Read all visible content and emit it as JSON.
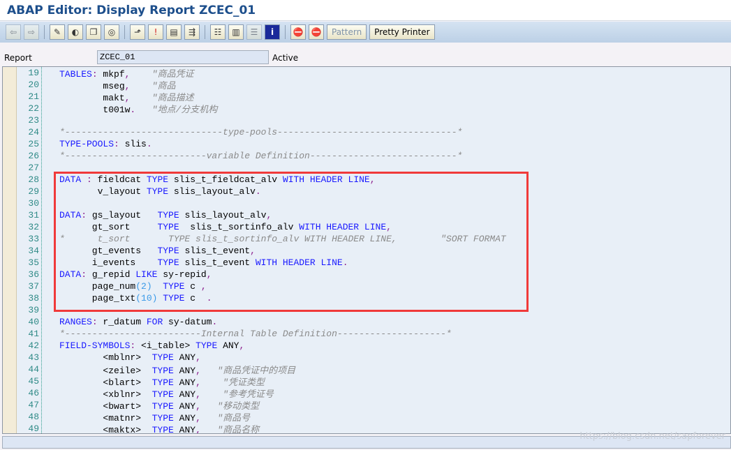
{
  "window_title": "ABAP Editor: Display Report ZCEC_01",
  "toolbar": {
    "icons": [
      "arrow-left-icon",
      "arrow-right-icon",
      "edit-pencil-icon",
      "toggle-active-icon",
      "object-copy-icon",
      "where-used-icon",
      "hierarchy-up-icon",
      "breakpoint-icon",
      "display-screen-icon",
      "navigate-icon",
      "object-tree-icon",
      "printer-icon",
      "list-icon",
      "info-icon",
      "stop-breakpoint-icon",
      "session-breakpoint-icon"
    ],
    "pattern_label": "Pattern",
    "pretty_printer_label": "Pretty Printer"
  },
  "report": {
    "label": "Report",
    "value": "ZCEC_01",
    "status": "Active"
  },
  "code_lines": [
    {
      "n": "19",
      "s": [
        [
          "k",
          "TABLES"
        ],
        [
          "p",
          ":"
        ],
        [
          "t",
          " mkpf"
        ],
        [
          "p",
          ","
        ],
        [
          "t",
          "    "
        ],
        [
          "c",
          "\"商品凭证"
        ]
      ]
    },
    {
      "n": "20",
      "s": [
        [
          "t",
          "        mseg"
        ],
        [
          "p",
          ","
        ],
        [
          "t",
          "    "
        ],
        [
          "c",
          "\"商品"
        ]
      ]
    },
    {
      "n": "21",
      "s": [
        [
          "t",
          "        makt"
        ],
        [
          "p",
          ","
        ],
        [
          "t",
          "    "
        ],
        [
          "c",
          "\"商品描述"
        ]
      ]
    },
    {
      "n": "22",
      "s": [
        [
          "t",
          "        t001w"
        ],
        [
          "p",
          "."
        ],
        [
          "t",
          "   "
        ],
        [
          "c",
          "\"地点/分支机构"
        ]
      ]
    },
    {
      "n": "23",
      "s": []
    },
    {
      "n": "24",
      "s": [
        [
          "c",
          "*-----------------------------type-pools---------------------------------*"
        ]
      ]
    },
    {
      "n": "25",
      "s": [
        [
          "k",
          "TYPE-POOLS"
        ],
        [
          "p",
          ":"
        ],
        [
          "t",
          " slis"
        ],
        [
          "p",
          "."
        ]
      ]
    },
    {
      "n": "26",
      "s": [
        [
          "c",
          "*--------------------------variable Definition---------------------------*"
        ]
      ]
    },
    {
      "n": "27",
      "s": []
    },
    {
      "n": "28",
      "s": [
        [
          "k",
          "DATA"
        ],
        [
          "t",
          " "
        ],
        [
          "p",
          ":"
        ],
        [
          "t",
          " fieldcat "
        ],
        [
          "k",
          "TYPE"
        ],
        [
          "t",
          " slis_t_fieldcat_alv "
        ],
        [
          "k",
          "WITH HEADER LINE"
        ],
        [
          "p",
          ","
        ]
      ]
    },
    {
      "n": "29",
      "s": [
        [
          "t",
          "       v_layout "
        ],
        [
          "k",
          "TYPE"
        ],
        [
          "t",
          " slis_layout_alv"
        ],
        [
          "p",
          "."
        ]
      ]
    },
    {
      "n": "30",
      "s": []
    },
    {
      "n": "31",
      "s": [
        [
          "k",
          "DATA"
        ],
        [
          "p",
          ":"
        ],
        [
          "t",
          " gs_layout   "
        ],
        [
          "k",
          "TYPE"
        ],
        [
          "t",
          " slis_layout_alv"
        ],
        [
          "p",
          ","
        ]
      ]
    },
    {
      "n": "32",
      "s": [
        [
          "t",
          "      gt_sort     "
        ],
        [
          "k",
          "TYPE"
        ],
        [
          "t",
          "  slis_t_sortinfo_alv "
        ],
        [
          "k",
          "WITH HEADER LINE"
        ],
        [
          "p",
          ","
        ]
      ]
    },
    {
      "n": "33",
      "s": [
        [
          "c",
          "*      t_sort       TYPE slis_t_sortinfo_alv WITH HEADER LINE,        \"SORT FORMAT"
        ]
      ]
    },
    {
      "n": "34",
      "s": [
        [
          "t",
          "      gt_events   "
        ],
        [
          "k",
          "TYPE"
        ],
        [
          "t",
          " slis_t_event"
        ],
        [
          "p",
          ","
        ]
      ]
    },
    {
      "n": "35",
      "s": [
        [
          "t",
          "      i_events    "
        ],
        [
          "k",
          "TYPE"
        ],
        [
          "t",
          " slis_t_event "
        ],
        [
          "k",
          "WITH HEADER LINE"
        ],
        [
          "p",
          "."
        ]
      ]
    },
    {
      "n": "36",
      "s": [
        [
          "k",
          "DATA"
        ],
        [
          "p",
          ":"
        ],
        [
          "t",
          " g_repid "
        ],
        [
          "k",
          "LIKE"
        ],
        [
          "t",
          " sy-repid"
        ],
        [
          "p",
          ","
        ]
      ]
    },
    {
      "n": "37",
      "s": [
        [
          "t",
          "      page_num"
        ],
        [
          "n",
          "(2)"
        ],
        [
          "t",
          "  "
        ],
        [
          "k",
          "TYPE"
        ],
        [
          "t",
          " c "
        ],
        [
          "p",
          ","
        ]
      ]
    },
    {
      "n": "38",
      "s": [
        [
          "t",
          "      page_txt"
        ],
        [
          "n",
          "(10)"
        ],
        [
          "t",
          " "
        ],
        [
          "k",
          "TYPE"
        ],
        [
          "t",
          " c  "
        ],
        [
          "p",
          "."
        ]
      ]
    },
    {
      "n": "39",
      "s": []
    },
    {
      "n": "40",
      "s": [
        [
          "k",
          "RANGES"
        ],
        [
          "p",
          ":"
        ],
        [
          "t",
          " r_datum "
        ],
        [
          "k",
          "FOR"
        ],
        [
          "t",
          " sy-datum"
        ],
        [
          "p",
          "."
        ]
      ]
    },
    {
      "n": "41",
      "s": [
        [
          "c",
          "*-------------------------Internal Table Definition--------------------*"
        ]
      ]
    },
    {
      "n": "42",
      "s": [
        [
          "k",
          "FIELD-SYMBOLS"
        ],
        [
          "p",
          ":"
        ],
        [
          "t",
          " <i_table> "
        ],
        [
          "k",
          "TYPE"
        ],
        [
          "t",
          " ANY"
        ],
        [
          "p",
          ","
        ]
      ]
    },
    {
      "n": "43",
      "s": [
        [
          "t",
          "        <mblnr>  "
        ],
        [
          "k",
          "TYPE"
        ],
        [
          "t",
          " ANY"
        ],
        [
          "p",
          ","
        ]
      ]
    },
    {
      "n": "44",
      "s": [
        [
          "t",
          "        <zeile>  "
        ],
        [
          "k",
          "TYPE"
        ],
        [
          "t",
          " ANY"
        ],
        [
          "p",
          ","
        ],
        [
          "t",
          "   "
        ],
        [
          "c",
          "\"商品凭证中的项目"
        ]
      ]
    },
    {
      "n": "45",
      "s": [
        [
          "t",
          "        <blart>  "
        ],
        [
          "k",
          "TYPE"
        ],
        [
          "t",
          " ANY"
        ],
        [
          "p",
          ","
        ],
        [
          "t",
          "    "
        ],
        [
          "c",
          "\"凭证类型"
        ]
      ]
    },
    {
      "n": "46",
      "s": [
        [
          "t",
          "        <xblnr>  "
        ],
        [
          "k",
          "TYPE"
        ],
        [
          "t",
          " ANY"
        ],
        [
          "p",
          ","
        ],
        [
          "t",
          "    "
        ],
        [
          "c",
          "\"参考凭证号"
        ]
      ]
    },
    {
      "n": "47",
      "s": [
        [
          "t",
          "        <bwart>  "
        ],
        [
          "k",
          "TYPE"
        ],
        [
          "t",
          " ANY"
        ],
        [
          "p",
          ","
        ],
        [
          "t",
          "   "
        ],
        [
          "c",
          "\"移动类型"
        ]
      ]
    },
    {
      "n": "48",
      "s": [
        [
          "t",
          "        <matnr>  "
        ],
        [
          "k",
          "TYPE"
        ],
        [
          "t",
          " ANY"
        ],
        [
          "p",
          ","
        ],
        [
          "t",
          "   "
        ],
        [
          "c",
          "\"商品号"
        ]
      ]
    },
    {
      "n": "49",
      "s": [
        [
          "t",
          "        <maktx>  "
        ],
        [
          "k",
          "TYPE"
        ],
        [
          "t",
          " ANY"
        ],
        [
          "p",
          ","
        ],
        [
          "t",
          "   "
        ],
        [
          "c",
          "\"商品名称"
        ]
      ]
    }
  ],
  "highlight_color": "#f03a3a",
  "watermark": "https://blog.csdn.net/sapforever"
}
